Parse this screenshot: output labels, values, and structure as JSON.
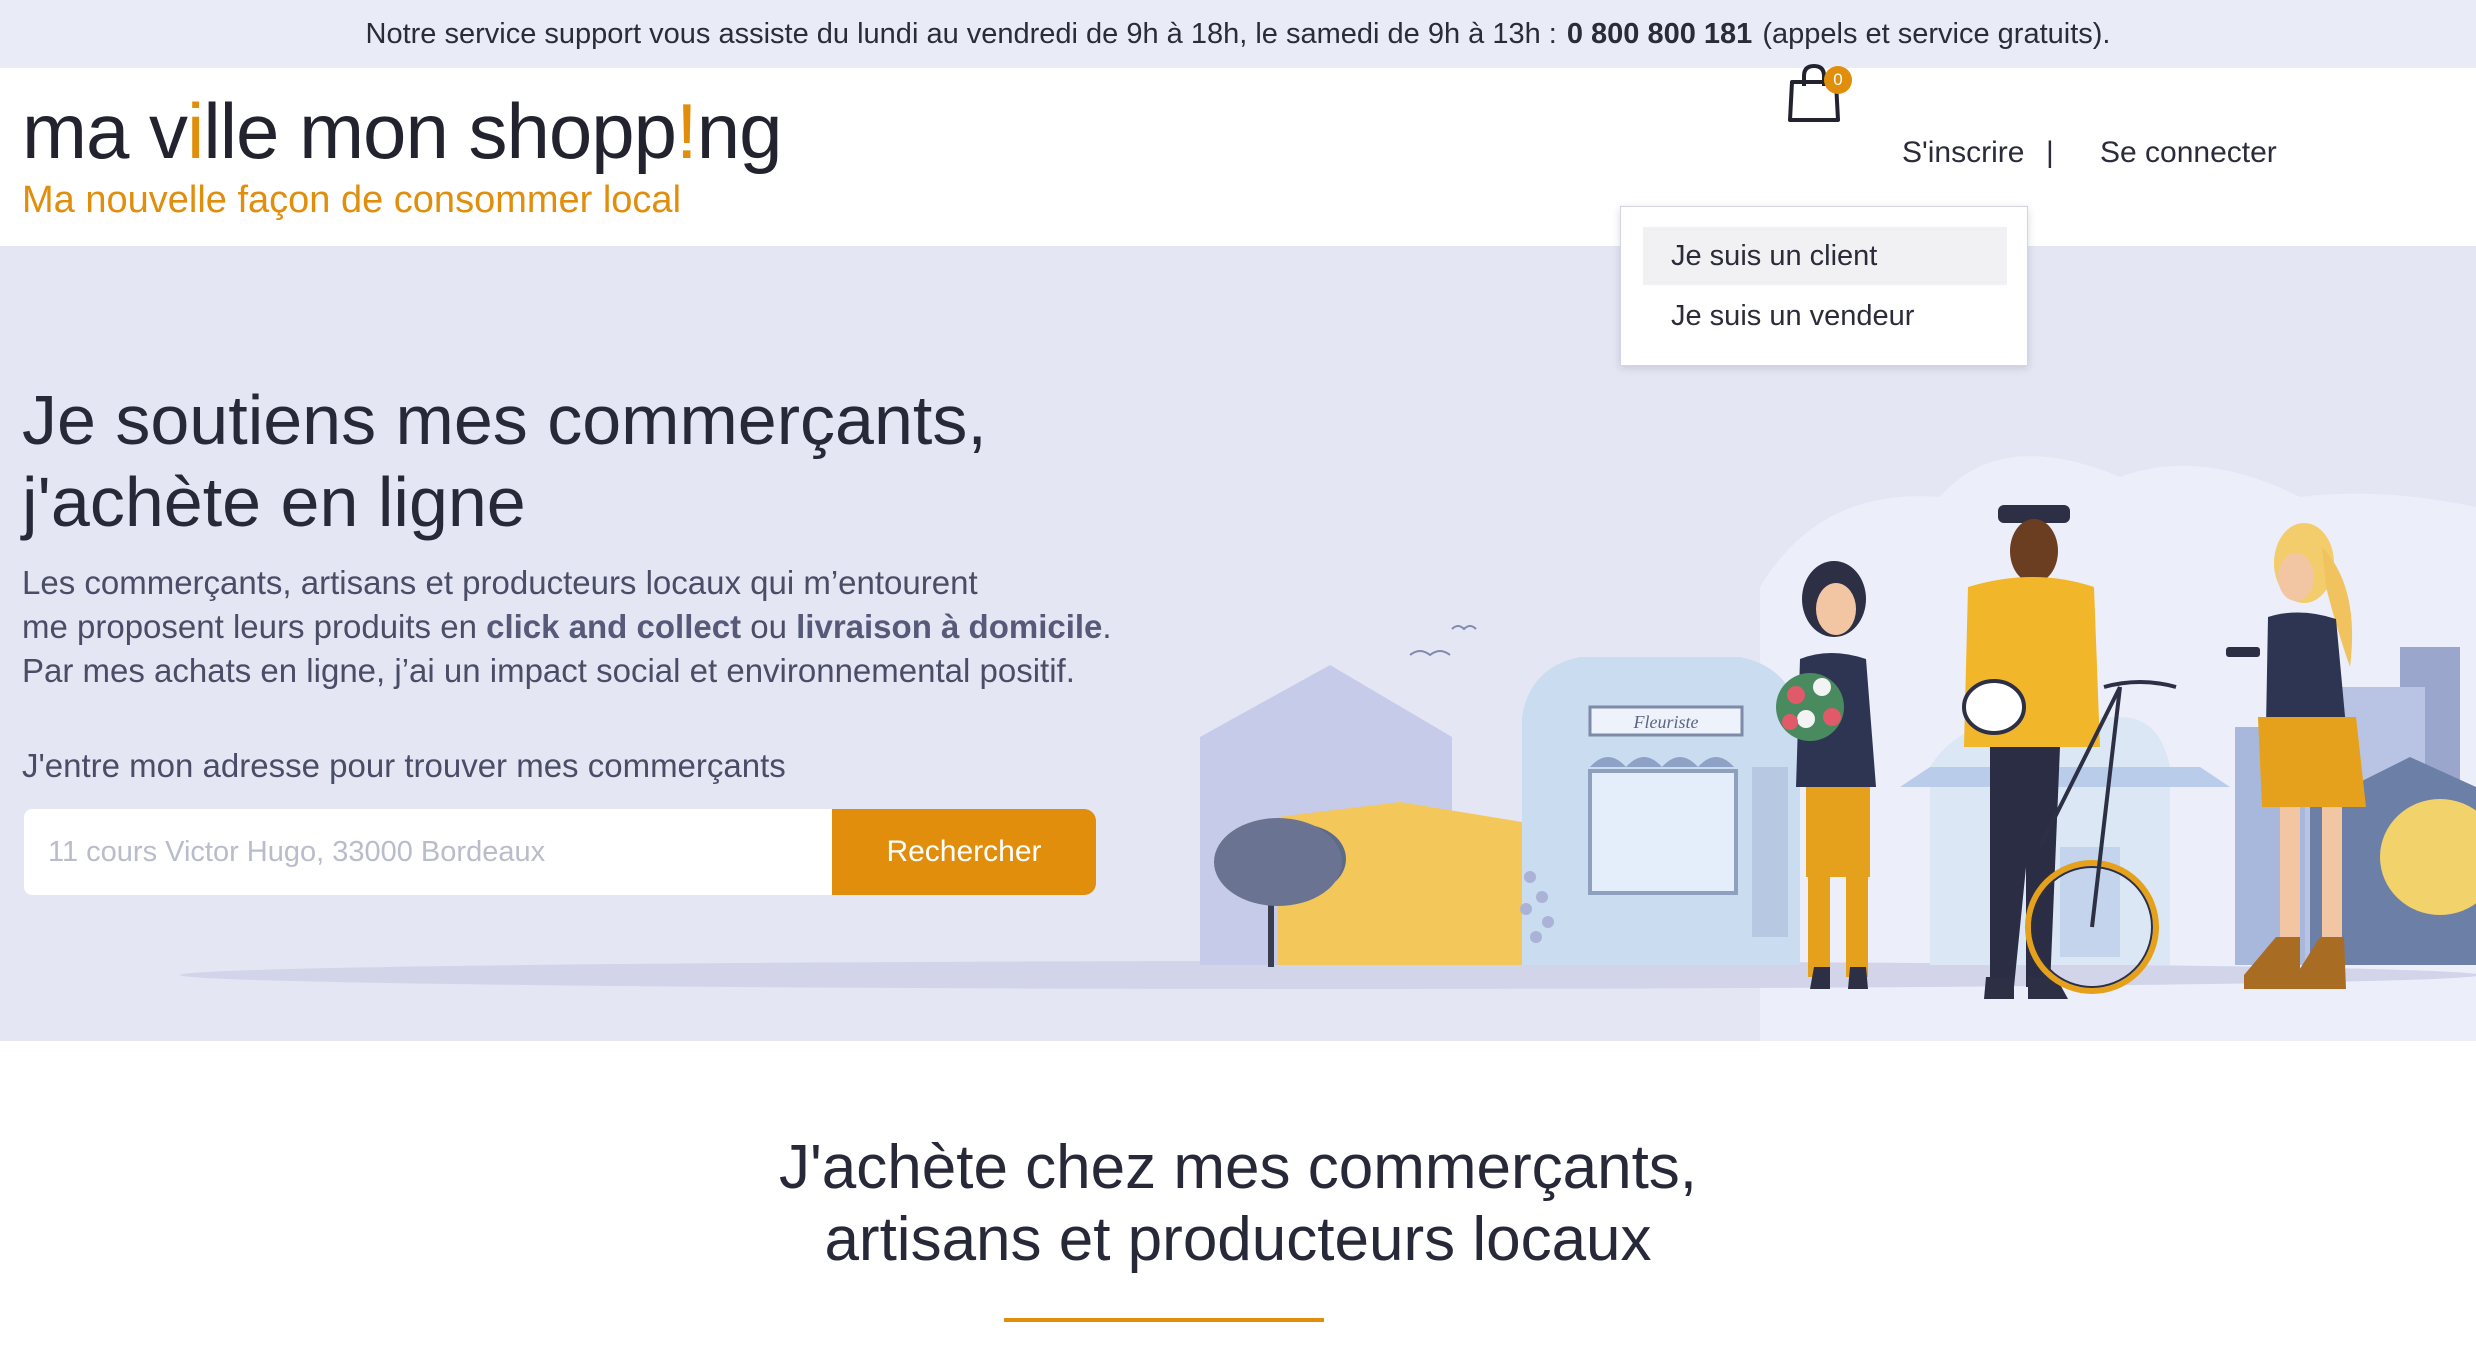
{
  "topbar": {
    "text_before": "Notre service support vous assiste du lundi au vendredi de 9h à 18h, le samedi de 9h à 13h :",
    "phone": "0 800 800 181",
    "text_after": "(appels et service gratuits)."
  },
  "header": {
    "logo": {
      "part1": "ma v",
      "accent1": "i",
      "part2": "lle mon shopp",
      "accent2": "!",
      "part3": "ng"
    },
    "tagline": "Ma nouvelle façon de consommer local",
    "cart_count": "0",
    "signup_label": "S'inscrire",
    "separator": "|",
    "login_label": "Se connecter"
  },
  "signup_dropdown": {
    "items": [
      {
        "label": "Je suis un client"
      },
      {
        "label": "Je suis un vendeur"
      }
    ]
  },
  "hero": {
    "title_line1": "Je soutiens mes commerçants,",
    "title_line2": "j'achète en ligne",
    "desc_line1": "Les commerçants, artisans et producteurs locaux qui m’entourent",
    "desc_line2_a": "me proposent leurs produits en",
    "desc_bold1": "click and collect",
    "desc_line2_b": "ou",
    "desc_bold2": "livraison à domicile",
    "desc_line2_c": ".",
    "desc_line3": "Par mes achats en ligne, j’ai un impact social et environnemental positif.",
    "address_label": "J'entre mon adresse pour trouver mes commerçants",
    "address_placeholder": "11 cours Victor Hugo, 33000 Bordeaux",
    "search_button": "Rechercher",
    "shop_sign": "Fleuriste"
  },
  "section": {
    "title_line1": "J'achète chez mes commerçants,",
    "title_line2": "artisans et producteurs locaux"
  },
  "colors": {
    "accent": "#e08e0b",
    "hero_bg": "#e4e6f4",
    "topbar_bg": "#e9ecf6",
    "text_dark": "#272838"
  }
}
